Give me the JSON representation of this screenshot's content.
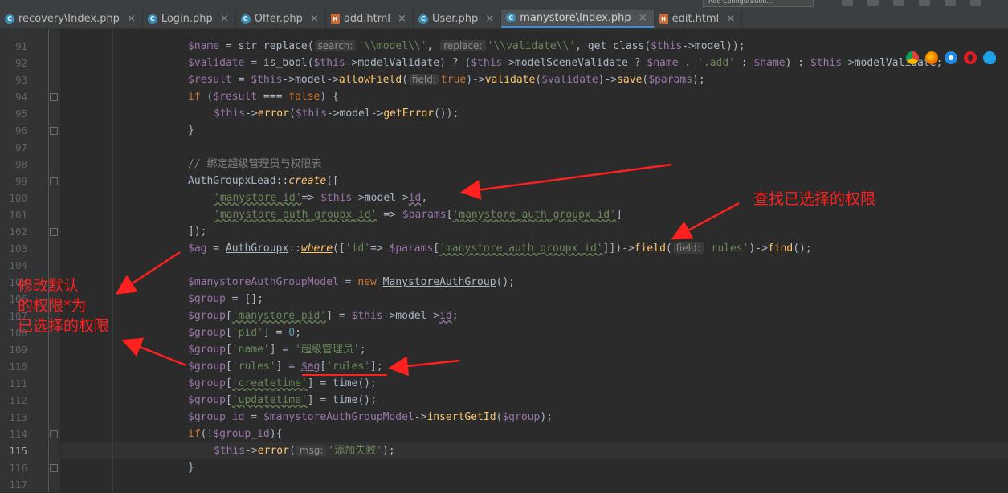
{
  "tabs": [
    {
      "label": "recovery\\Index.php",
      "type": "php",
      "active": false
    },
    {
      "label": "Login.php",
      "type": "php",
      "active": false
    },
    {
      "label": "Offer.php",
      "type": "php",
      "active": false
    },
    {
      "label": "add.html",
      "type": "html",
      "active": false
    },
    {
      "label": "User.php",
      "type": "php",
      "active": false
    },
    {
      "label": "manystore\\Index.php",
      "type": "php",
      "active": true
    },
    {
      "label": "edit.html",
      "type": "html",
      "active": false
    }
  ],
  "toolbar": {
    "config_label": "Add Configuration..."
  },
  "editor": {
    "current_line": "115",
    "line_numbers": [
      "91",
      "92",
      "93",
      "94",
      "95",
      "96",
      "97",
      "98",
      "99",
      "100",
      "101",
      "102",
      "103",
      "104",
      "105",
      "106",
      "107",
      "108",
      "109",
      "110",
      "111",
      "112",
      "113",
      "114",
      "115",
      "116",
      "117"
    ],
    "hints": {
      "search": "search:",
      "replace": "replace:",
      "field1": "field:",
      "field2": "field:",
      "msg": "msg:"
    },
    "strings": {
      "model": "'\\\\model\\\\'",
      "validate": "'\\\\validate\\\\'",
      "add": "'.add'",
      "comment": "// 绑定超级管理员与权限表",
      "manystore_id": "'manystore_id'",
      "manystore_auth_groupx_id": "'manystore_auth_groupx_id'",
      "id": "'id'",
      "rules": "'rules'",
      "manystore_pid": "'manystore_pid'",
      "pid": "'pid'",
      "name": "'name'",
      "super_admin": "'超级管理员'",
      "createtime": "'createtime'",
      "updatetime": "'updatetime'",
      "fail": "'添加失败'"
    }
  },
  "annotations": {
    "find_selected": "查找已选择的权限",
    "modify_default": "修改默认\n的权限*为\n已选择的权限"
  },
  "browser_icons": [
    "chrome-icon",
    "firefox-icon",
    "safari-icon",
    "opera-icon",
    "ie-icon"
  ]
}
